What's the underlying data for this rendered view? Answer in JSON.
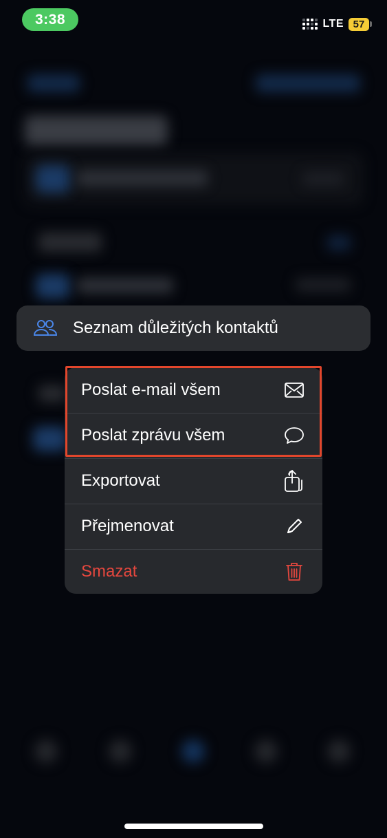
{
  "status_bar": {
    "time": "3:38",
    "network": "LTE",
    "battery_level": "57",
    "time_pill_color": "#4cc961",
    "battery_color": "#f5cc36"
  },
  "preview": {
    "label": "Seznam důležitých kontaktů",
    "icon": "people-icon",
    "icon_color": "#4a86e8"
  },
  "menu": {
    "items": [
      {
        "label": "Poslat e-mail všem",
        "icon": "envelope-icon"
      },
      {
        "label": "Poslat zprávu všem",
        "icon": "message-bubble-icon"
      },
      {
        "label": "Exportovat",
        "icon": "share-icon"
      },
      {
        "label": "Přejmenovat",
        "icon": "pencil-icon"
      },
      {
        "label": "Smazat",
        "icon": "trash-icon",
        "destructive": true
      }
    ],
    "destructive_color": "#e5473e",
    "highlight_color": "#e2462c"
  }
}
